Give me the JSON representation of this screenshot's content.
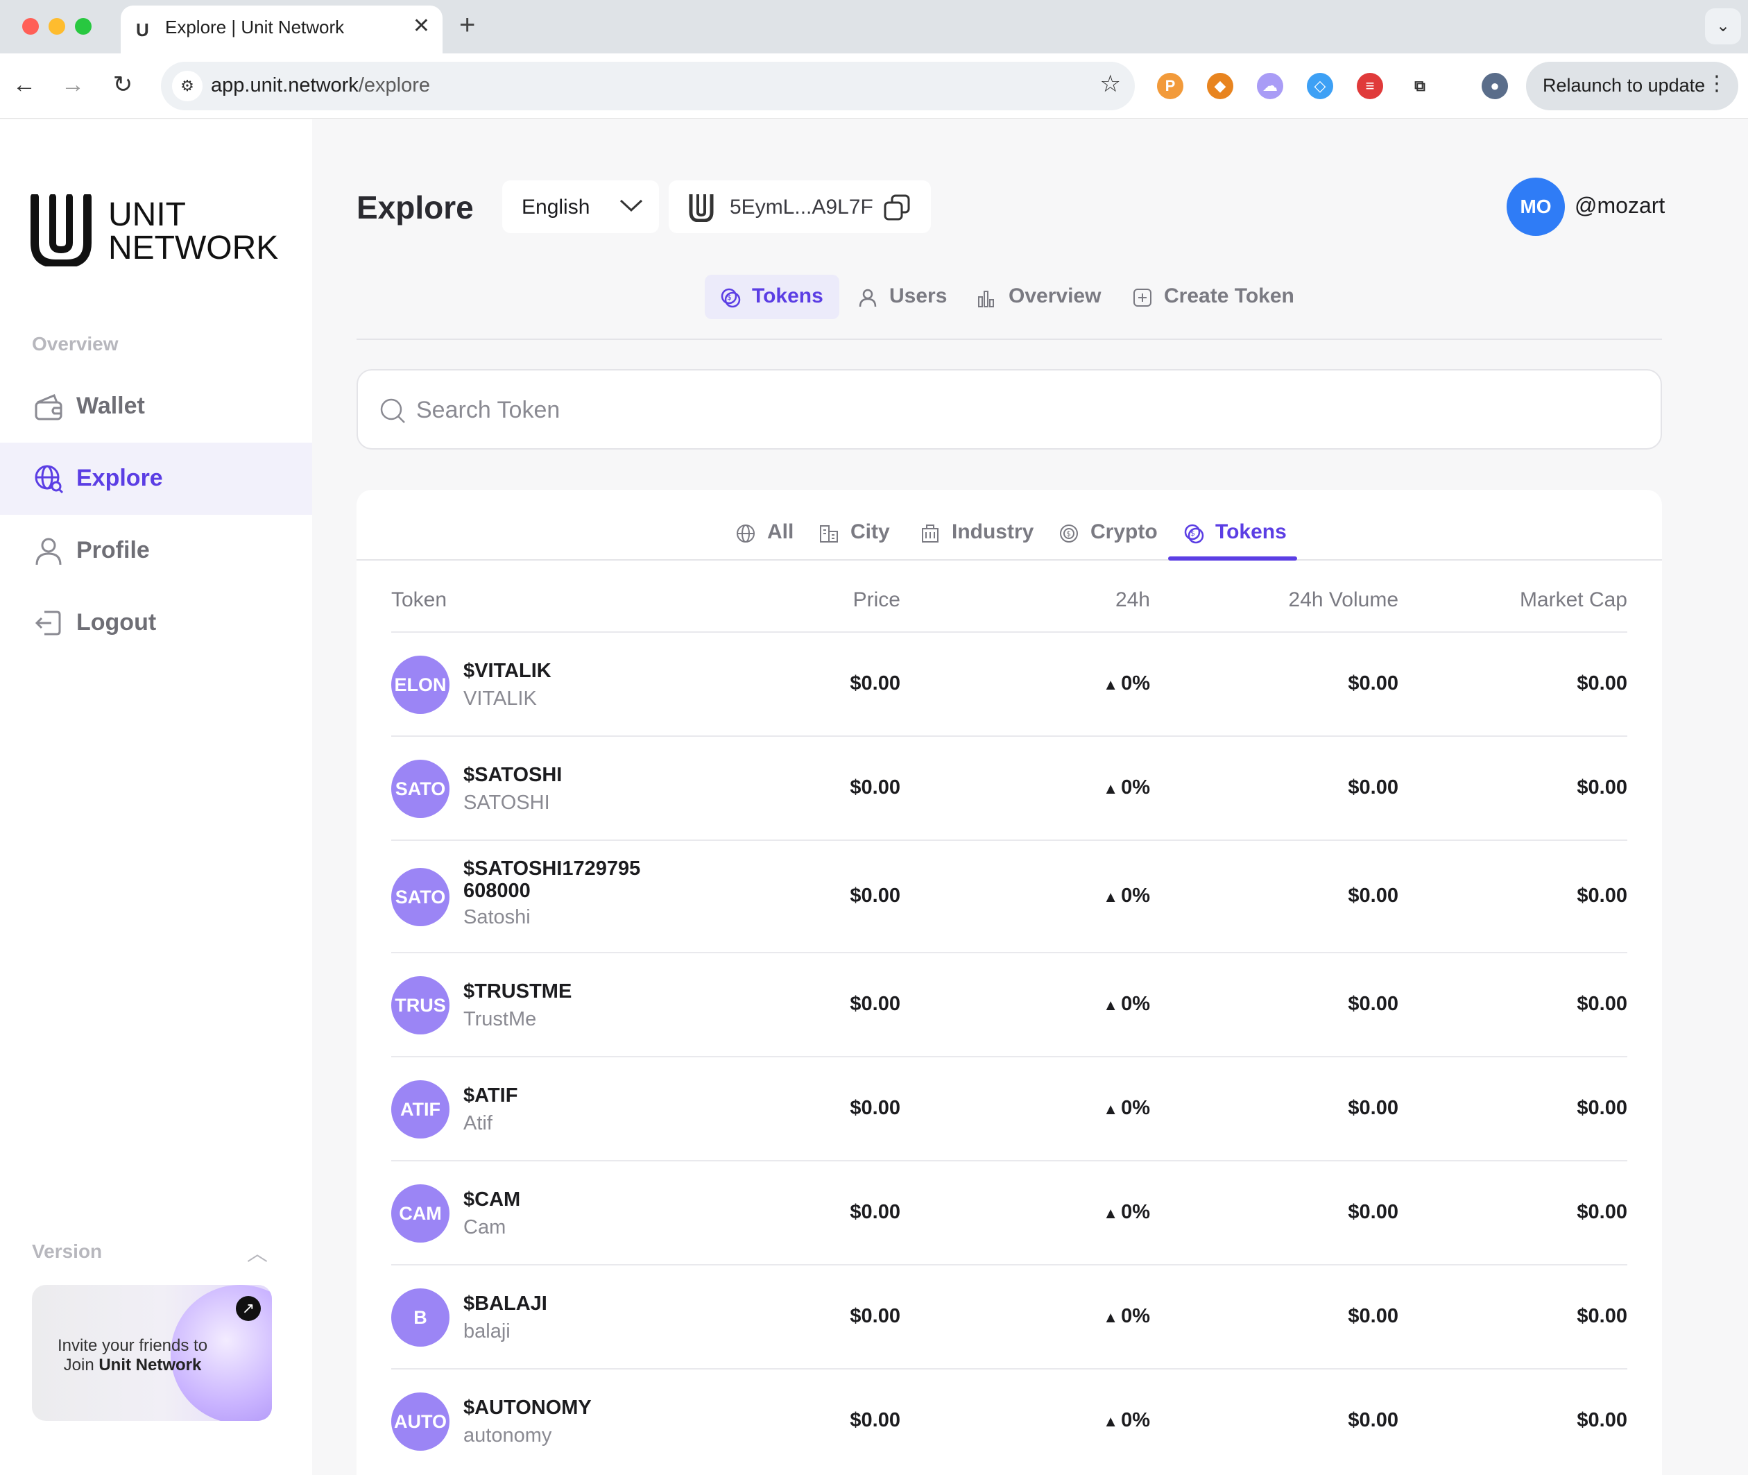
{
  "browser": {
    "tab_title": "Explore | Unit Network",
    "tab_favicon": "U",
    "url_domain": "app.unit.network",
    "url_path": "/explore",
    "relaunch_label": "Relaunch to update"
  },
  "sidebar": {
    "logo_line1": "UNIT",
    "logo_line2": "NETWORK",
    "section_label": "Overview",
    "items": [
      {
        "label": "Wallet",
        "icon": "wallet-icon"
      },
      {
        "label": "Explore",
        "icon": "globe-search-icon",
        "active": true
      },
      {
        "label": "Profile",
        "icon": "user-icon"
      },
      {
        "label": "Logout",
        "icon": "logout-icon"
      }
    ],
    "version_label": "Version",
    "invite_line": "Invite your friends to Join ",
    "invite_brand": "Unit Network"
  },
  "header": {
    "title": "Explore",
    "language": "English",
    "wallet_address": "5EymL...A9L7F",
    "avatar_initials": "MO",
    "username": "@mozart"
  },
  "top_tabs": [
    {
      "label": "Tokens",
      "icon": "coin-icon",
      "active": true
    },
    {
      "label": "Users",
      "icon": "user-icon"
    },
    {
      "label": "Overview",
      "icon": "bar-chart-icon"
    },
    {
      "label": "Create Token",
      "icon": "plus-square-icon"
    }
  ],
  "search": {
    "placeholder": "Search Token"
  },
  "category_tabs": [
    {
      "label": "All",
      "icon": "globe-icon"
    },
    {
      "label": "City",
      "icon": "city-icon"
    },
    {
      "label": "Industry",
      "icon": "building-icon"
    },
    {
      "label": "Crypto",
      "icon": "crypto-icon"
    },
    {
      "label": "Tokens",
      "icon": "coin-icon",
      "active": true
    }
  ],
  "table": {
    "columns": [
      "Token",
      "Price",
      "24h",
      "24h Volume",
      "Market Cap"
    ],
    "rows": [
      {
        "avatar": "ELON",
        "symbol": "$VITALIK",
        "name": "VITALIK",
        "price": "$0.00",
        "change": "0%",
        "volume": "$0.00",
        "market_cap": "$0.00"
      },
      {
        "avatar": "SATO",
        "symbol": "$SATOSHI",
        "name": "SATOSHI",
        "price": "$0.00",
        "change": "0%",
        "volume": "$0.00",
        "market_cap": "$0.00"
      },
      {
        "avatar": "SATO",
        "symbol": "$SATOSHI1729795608000",
        "name": "Satoshi",
        "price": "$0.00",
        "change": "0%",
        "volume": "$0.00",
        "market_cap": "$0.00"
      },
      {
        "avatar": "TRUS",
        "symbol": "$TRUSTME",
        "name": "TrustMe",
        "price": "$0.00",
        "change": "0%",
        "volume": "$0.00",
        "market_cap": "$0.00"
      },
      {
        "avatar": "ATIF",
        "symbol": "$ATIF",
        "name": "Atif",
        "price": "$0.00",
        "change": "0%",
        "volume": "$0.00",
        "market_cap": "$0.00"
      },
      {
        "avatar": "CAM",
        "symbol": "$CAM",
        "name": "Cam",
        "price": "$0.00",
        "change": "0%",
        "volume": "$0.00",
        "market_cap": "$0.00"
      },
      {
        "avatar": "B",
        "symbol": "$BALAJI",
        "name": "balaji",
        "price": "$0.00",
        "change": "0%",
        "volume": "$0.00",
        "market_cap": "$0.00"
      },
      {
        "avatar": "AUTO",
        "symbol": "$AUTONOMY",
        "name": "autonomy",
        "price": "$0.00",
        "change": "0%",
        "volume": "$0.00",
        "market_cap": "$0.00"
      }
    ]
  },
  "colors": {
    "accent": "#5b3ee4",
    "avatar_token": "#9b85f5",
    "avatar_user": "#2f7cf6"
  }
}
